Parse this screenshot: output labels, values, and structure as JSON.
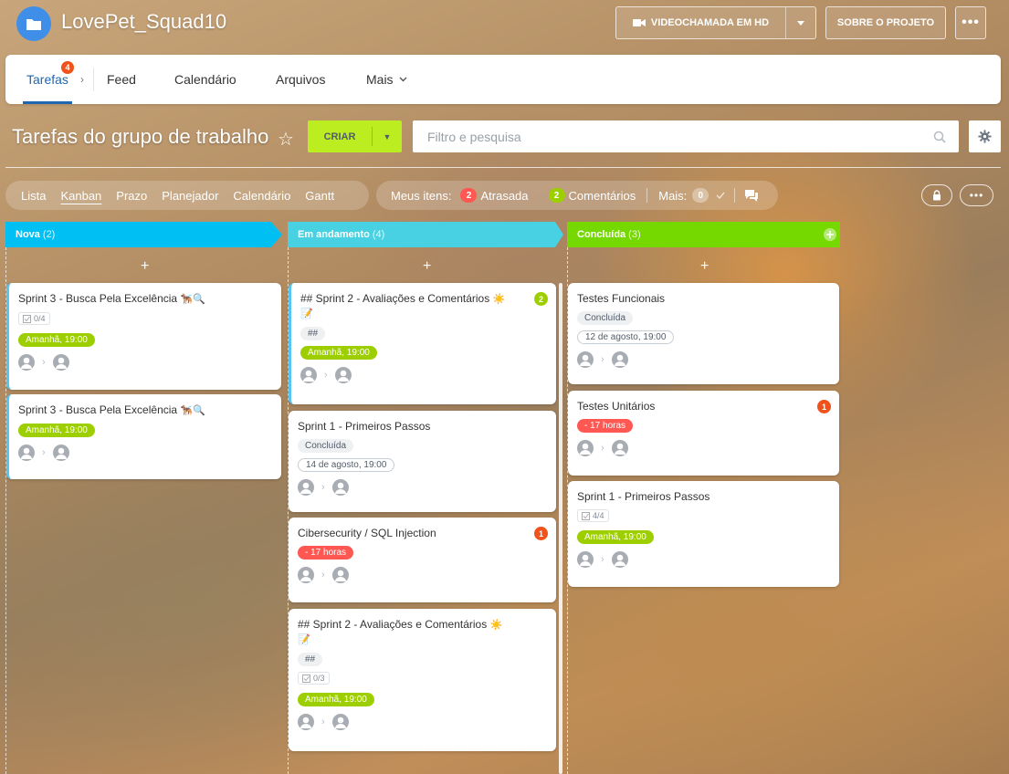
{
  "header": {
    "title": "LovePet_Squad10",
    "video_label": "VIDEOCHAMADA EM HD",
    "about_label": "SOBRE O PROJETO",
    "more_label": "•••"
  },
  "tabs": [
    {
      "label": "Tarefas",
      "counter": "4"
    },
    {
      "label": "Feed"
    },
    {
      "label": "Calendário"
    },
    {
      "label": "Arquivos"
    },
    {
      "label": "Mais"
    }
  ],
  "toolbar": {
    "page_title": "Tarefas do grupo de trabalho",
    "create_label": "CRIAR",
    "search_placeholder": "Filtro e pesquisa"
  },
  "views": [
    "Lista",
    "Kanban",
    "Prazo",
    "Planejador",
    "Calendário",
    "Gantt"
  ],
  "my_items": {
    "label": "Meus itens:",
    "overdue_count": "2",
    "overdue_label": "Atrasada",
    "comments_count": "2",
    "comments_label": "Comentários",
    "more_label": "Mais:",
    "more_count": "0"
  },
  "columns": [
    {
      "name": "Nova",
      "count": "(2)",
      "color": "#00bff3"
    },
    {
      "name": "Em andamento",
      "count": "(4)",
      "color": "#47d1e2"
    },
    {
      "name": "Concluída",
      "count": "(3)",
      "color": "#75d900"
    }
  ],
  "cards": {
    "c1": {
      "title": "Sprint 3 - Busca Pela Excelência",
      "emoji": "🐕‍🦺🔍",
      "checklist": "0/4",
      "deadline": "Amanhã, 19:00"
    },
    "c2": {
      "title": "Sprint 3 - Busca Pela Excelência",
      "emoji": "🐕‍🦺🔍",
      "deadline": "Amanhã, 19:00"
    },
    "c3": {
      "title": "## Sprint 2 - Avaliações e Comentários",
      "emoji": "☀️",
      "emoji2": "📝",
      "counter": "2",
      "tag": "##",
      "deadline": "Amanhã, 19:00"
    },
    "c4": {
      "title": "Sprint 1 - Primeiros Passos",
      "status": "Concluída",
      "deadline": "14 de agosto, 19:00"
    },
    "c5": {
      "title": "Cibersecurity / SQL Injection",
      "counter": "1",
      "deadline": "- 17 horas"
    },
    "c6": {
      "title": "## Sprint 2 - Avaliações e Comentários",
      "emoji": "☀️",
      "emoji2": "📝",
      "tag": "##",
      "checklist": "0/3",
      "deadline": "Amanhã, 19:00"
    },
    "c7": {
      "title": "Testes Funcionais",
      "status": "Concluída",
      "deadline": "12 de agosto, 19:00"
    },
    "c8": {
      "title": "Testes Unitários",
      "counter": "1",
      "deadline": "- 17 horas"
    },
    "c9": {
      "title": "Sprint 1 - Primeiros Passos",
      "checklist": "4/4",
      "deadline": "Amanhã, 19:00"
    }
  },
  "colors": {
    "create_green": "#bbed21",
    "deadline_green": "#9dcf00",
    "overdue_red": "#ff5752",
    "counter_orange": "#f0521c",
    "active_tab_blue": "#2067b0"
  }
}
